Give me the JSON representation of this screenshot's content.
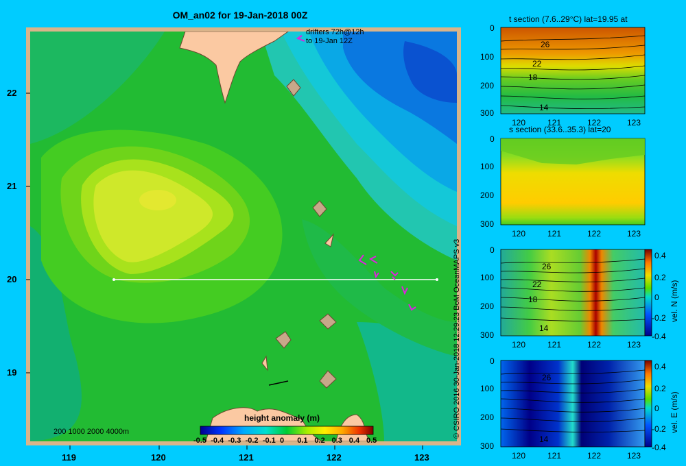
{
  "map": {
    "title": "OM_an02 for 19-Jan-2018 00Z",
    "drifters_line1": "drifters 72h@12h",
    "drifters_line2": "to 19-Jan 12Z",
    "depth_legend": "200  1000  2000  4000m",
    "lat_ticks": [
      "22",
      "21",
      "20",
      "19"
    ],
    "lon_ticks": [
      "119",
      "120",
      "121",
      "122",
      "123"
    ],
    "colorbar_title": "height anomaly (m)",
    "colorbar_ticks": [
      "-0.5",
      "-0.4",
      "-0.3",
      "-0.2",
      "-0.1",
      "0",
      "0.1",
      "0.2",
      "0.3",
      "0.4",
      "0.5"
    ],
    "section_line_lat": "20"
  },
  "credit": "© CSIRO 2016   30-Jan-2018 12:29:23 BoM OceanMAPS v3",
  "panels": [
    {
      "id": "t-section",
      "title": "t section (7.6..29°C) lat=19.95 at",
      "y_ticks": [
        "0",
        "100",
        "200",
        "300"
      ],
      "x_ticks": [
        "120",
        "121",
        "122",
        "123"
      ],
      "contour_labels": [
        "26",
        "22",
        "18",
        "14"
      ]
    },
    {
      "id": "s-section",
      "title": "s section (33.6..35.3) lat=20",
      "y_ticks": [
        "0",
        "100",
        "200",
        "300"
      ],
      "x_ticks": [
        "120",
        "121",
        "122",
        "123"
      ]
    },
    {
      "id": "vn-section",
      "title": "",
      "y_ticks": [
        "0",
        "100",
        "200",
        "300"
      ],
      "x_ticks": [
        "120",
        "121",
        "122",
        "123"
      ],
      "contour_labels": [
        "26",
        "22",
        "18",
        "14"
      ],
      "colorbar_label": "vel. N (m/s)",
      "colorbar_ticks": [
        "0.4",
        "0.2",
        "0",
        "-0.2",
        "-0.4"
      ]
    },
    {
      "id": "ve-section",
      "title": "",
      "y_ticks": [
        "0",
        "100",
        "200",
        "300"
      ],
      "x_ticks": [
        "120",
        "121",
        "122",
        "123"
      ],
      "contour_labels": [
        "26",
        "14"
      ],
      "colorbar_label": "vel. E (m/s)",
      "colorbar_ticks": [
        "0.4",
        "0.2",
        "0",
        "-0.2",
        "-0.4"
      ]
    }
  ]
}
